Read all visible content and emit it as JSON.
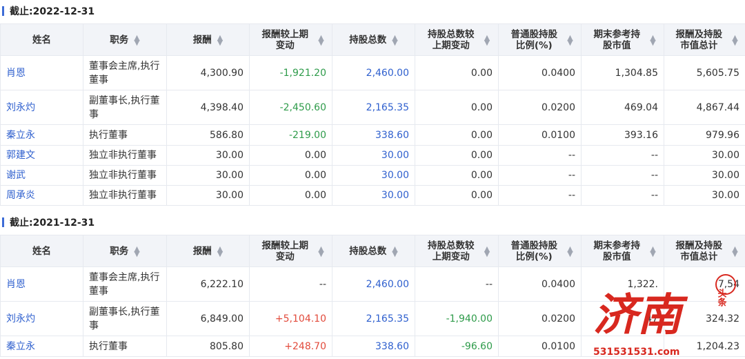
{
  "sections": [
    {
      "title": "截止:2022-12-31",
      "headers": [
        "姓名",
        "职务",
        "报酬",
        "报酬较上期变动",
        "持股总数",
        "持股总数较上期变动",
        "普通股持股比例(%)",
        "期末参考持股市值",
        "报酬及持股市值总计"
      ],
      "rows": [
        {
          "name": "肖恩",
          "role": "董事会主席,执行董事",
          "pay": "4,300.90",
          "pay_change": "-1,921.20",
          "shares": "2,460.00",
          "share_change": "0.00",
          "ratio": "0.0400",
          "mkt": "1,304.85",
          "total": "5,605.75"
        },
        {
          "name": "刘永灼",
          "role": "副董事长,执行董事",
          "pay": "4,398.40",
          "pay_change": "-2,450.60",
          "shares": "2,165.35",
          "share_change": "0.00",
          "ratio": "0.0200",
          "mkt": "469.04",
          "total": "4,867.44"
        },
        {
          "name": "秦立永",
          "role": "执行董事",
          "pay": "586.80",
          "pay_change": "-219.00",
          "shares": "338.60",
          "share_change": "0.00",
          "ratio": "0.0100",
          "mkt": "393.16",
          "total": "979.96"
        },
        {
          "name": "郭建文",
          "role": "独立非执行董事",
          "pay": "30.00",
          "pay_change": "0.00",
          "shares": "30.00",
          "share_change": "0.00",
          "ratio": "--",
          "mkt": "--",
          "total": "30.00"
        },
        {
          "name": "谢武",
          "role": "独立非执行董事",
          "pay": "30.00",
          "pay_change": "0.00",
          "shares": "30.00",
          "share_change": "0.00",
          "ratio": "--",
          "mkt": "--",
          "total": "30.00"
        },
        {
          "name": "周承炎",
          "role": "独立非执行董事",
          "pay": "30.00",
          "pay_change": "0.00",
          "shares": "30.00",
          "share_change": "0.00",
          "ratio": "--",
          "mkt": "--",
          "total": "30.00"
        }
      ]
    },
    {
      "title": "截止:2021-12-31",
      "headers": [
        "姓名",
        "职务",
        "报酬",
        "报酬较上期变动",
        "持股总数",
        "持股总数较上期变动",
        "普通股持股比例(%)",
        "期末参考持股市值",
        "报酬及持股市值总计"
      ],
      "rows": [
        {
          "name": "肖恩",
          "role": "董事会主席,执行董事",
          "pay": "6,222.10",
          "pay_change": "--",
          "shares": "2,460.00",
          "share_change": "--",
          "ratio": "0.0400",
          "mkt": "1,322.",
          "total": "7,54"
        },
        {
          "name": "刘永灼",
          "role": "副董事长,执行董事",
          "pay": "6,849.00",
          "pay_change": "+5,104.10",
          "shares": "2,165.35",
          "share_change": "-1,940.00",
          "ratio": "0.0200",
          "mkt": "47",
          "total": "324.32"
        },
        {
          "name": "秦立永",
          "role": "执行董事",
          "pay": "805.80",
          "pay_change": "+248.70",
          "shares": "338.60",
          "share_change": "-96.60",
          "ratio": "0.0100",
          "mkt": "",
          "total": "1,204.23"
        }
      ]
    }
  ],
  "watermark": {
    "text": "济南",
    "badge": "头条",
    "url": "531531531.com"
  }
}
